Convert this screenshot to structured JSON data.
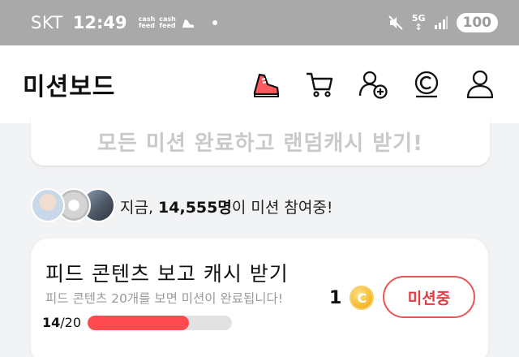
{
  "status_bar": {
    "carrier": "SKT",
    "time": "12:49",
    "notif_app_1": "cash feed",
    "notif_app_2": "cash feed",
    "network": "5G",
    "battery": "100"
  },
  "header": {
    "title": "미션보드",
    "icons": [
      "sneaker-icon",
      "cart-icon",
      "add-friend-icon",
      "cash-icon",
      "profile-icon"
    ]
  },
  "banner": {
    "text": "모든 미션 완료하고 랜덤캐시 받기!"
  },
  "participants": {
    "prefix": "지금, ",
    "count": "14,555명",
    "suffix": "이 미션 참여중!"
  },
  "mission": {
    "title": "피드 콘텐츠 보고 캐시 받기",
    "description": "피드 콘텐츠 20개를 보면 미션이 완료됩니다!",
    "progress_current": "14",
    "progress_total": "/20",
    "progress_fraction": 0.7,
    "reward": "1",
    "coin_symbol": "C",
    "button_label": "미션중"
  },
  "colors": {
    "accent": "#ff4a4f",
    "status_bar": "#a9a9a9",
    "coin": "#f4b92a"
  }
}
